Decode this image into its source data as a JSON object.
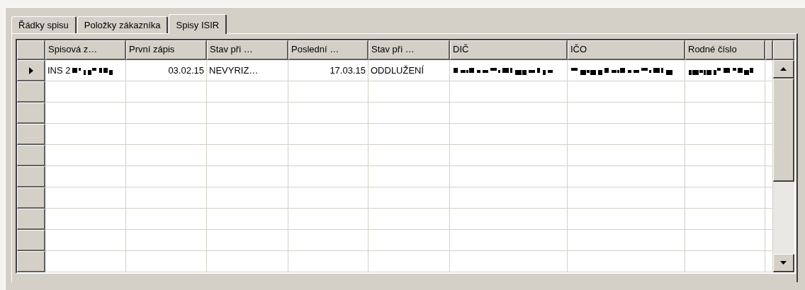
{
  "tabs": [
    {
      "label": "Řádky spisu",
      "selected": false
    },
    {
      "label": "Položky zákazníka",
      "selected": false
    },
    {
      "label": "Spisy ISIR",
      "selected": true
    }
  ],
  "table": {
    "columns": [
      {
        "label": "Spisová z…",
        "kind": "text"
      },
      {
        "label": "První zápis",
        "kind": "date"
      },
      {
        "label": "Stav při …",
        "kind": "text"
      },
      {
        "label": "Poslední …",
        "kind": "date"
      },
      {
        "label": "Stav při …",
        "kind": "text"
      },
      {
        "label": "DIČ",
        "kind": "text"
      },
      {
        "label": "IČO",
        "kind": "text"
      },
      {
        "label": "Rodné číslo",
        "kind": "text"
      }
    ],
    "rows": [
      {
        "current": true,
        "cells": [
          {
            "text": "INS 2",
            "redacted": true
          },
          {
            "text": "03.02.15",
            "redacted": false
          },
          {
            "text": "NEVYRIZ…",
            "redacted": false
          },
          {
            "text": "17.03.15",
            "redacted": false
          },
          {
            "text": "ODDLUŽENÍ",
            "redacted": false
          },
          {
            "redacted": true
          },
          {
            "redacted": true
          },
          {
            "redacted": true
          }
        ]
      },
      {
        "current": false
      },
      {
        "current": false
      },
      {
        "current": false
      },
      {
        "current": false
      },
      {
        "current": false
      },
      {
        "current": false
      },
      {
        "current": false
      },
      {
        "current": false
      },
      {
        "current": false
      }
    ]
  }
}
